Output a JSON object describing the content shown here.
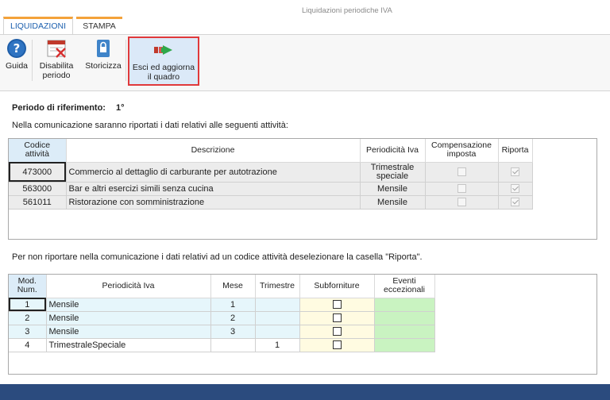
{
  "window": {
    "title": "Liquidazioni periodiche IVA"
  },
  "ribbon": {
    "tabs": [
      {
        "label": "LIQUIDAZIONI"
      },
      {
        "label": "STAMPA"
      }
    ],
    "buttons": {
      "guida": "Guida",
      "disabilita_1": "Disabilita",
      "disabilita_2": "periodo",
      "storicizza": "Storicizza",
      "esci_1": "Esci ed aggiorna",
      "esci_2": "il quadro"
    }
  },
  "period": {
    "label": "Periodo di riferimento:",
    "value": "1°"
  },
  "intro_text": "Nella comunicazione saranno riportati i dati relativi alle seguenti attività:",
  "activities": {
    "headers": {
      "codice_1": "Codice",
      "codice_2": "attività",
      "descrizione": "Descrizione",
      "periodicita": "Periodicità Iva",
      "compensazione_1": "Compensazione",
      "compensazione_2": "imposta",
      "riporta": "Riporta"
    },
    "rows": [
      {
        "codice": "473000",
        "descrizione": "Commercio al dettaglio di carburante per autotrazione",
        "periodicita_1": "Trimestrale",
        "periodicita_2": "speciale",
        "compensazione": false,
        "riporta": true
      },
      {
        "codice": "563000",
        "descrizione": "Bar e altri esercizi simili senza cucina",
        "periodicita_1": "Mensile",
        "periodicita_2": "",
        "compensazione": false,
        "riporta": true
      },
      {
        "codice": "561011",
        "descrizione": "Ristorazione con somministrazione",
        "periodicita_1": "Mensile",
        "periodicita_2": "",
        "compensazione": false,
        "riporta": true
      }
    ]
  },
  "note_text": "Per non riportare nella comunicazione i dati relativi ad un codice attività deselezionare la casella \"Riporta\".",
  "modules": {
    "headers": {
      "mod_1": "Mod.",
      "mod_2": "Num.",
      "periodicita": "Periodicità Iva",
      "mese": "Mese",
      "trimestre": "Trimestre",
      "subforniture": "Subforniture",
      "eventi_1": "Eventi",
      "eventi_2": "eccezionali"
    },
    "rows": [
      {
        "num": "1",
        "periodicita": "Mensile",
        "mese": "1",
        "trimestre": "",
        "subforniture": false,
        "eventi": ""
      },
      {
        "num": "2",
        "periodicita": "Mensile",
        "mese": "2",
        "trimestre": "",
        "subforniture": false,
        "eventi": ""
      },
      {
        "num": "3",
        "periodicita": "Mensile",
        "mese": "3",
        "trimestre": "",
        "subforniture": false,
        "eventi": ""
      },
      {
        "num": "4",
        "periodicita": "TrimestraleSpeciale",
        "mese": "",
        "trimestre": "1",
        "subforniture": false,
        "eventi": ""
      }
    ]
  },
  "colors": {
    "accent_tab": "#f4a23a",
    "tab_text": "#1b5fae",
    "highlight_border": "#e0393b",
    "bottom_bar": "#2b4b7e",
    "eventi_cell": "#c9f3c1",
    "subforniture_cell": "#fffbe1"
  }
}
